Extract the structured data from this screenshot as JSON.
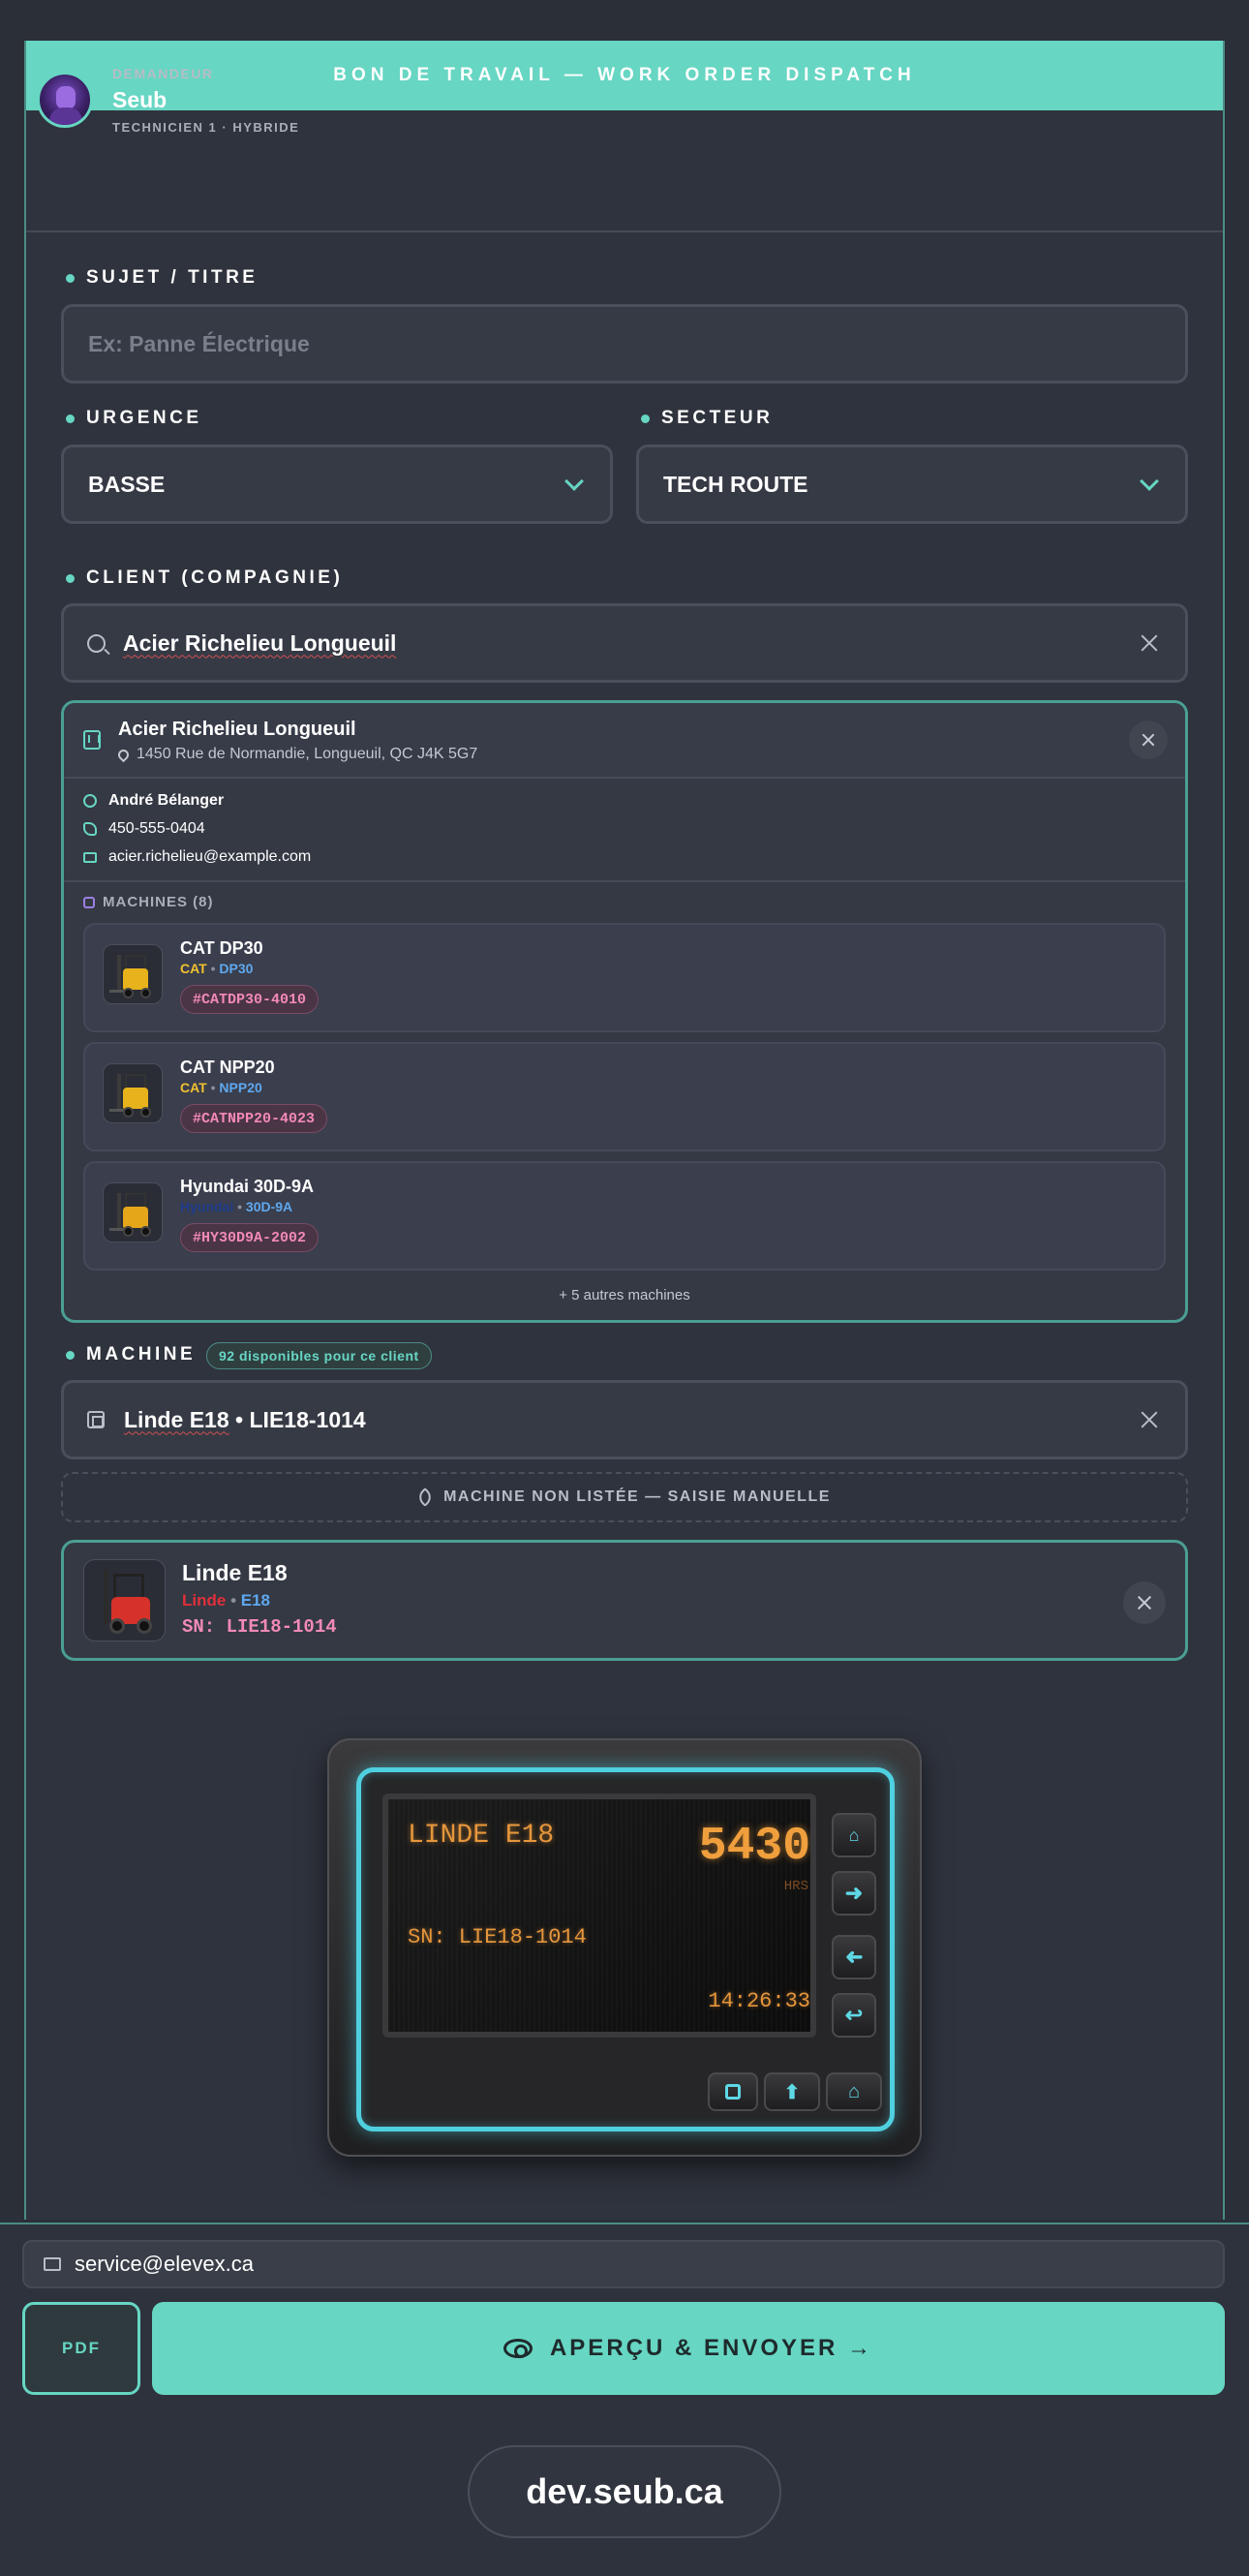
{
  "header": {
    "banner": "BON DE TRAVAIL — WORK ORDER DISPATCH"
  },
  "requester": {
    "label": "DEMANDEUR",
    "name": "Seub",
    "role": "TECHNICIEN 1 · HYBRIDE"
  },
  "form": {
    "subject": {
      "label": "SUJET / TITRE",
      "placeholder": "Ex: Panne Électrique",
      "value": ""
    },
    "urgency": {
      "label": "URGENCE",
      "value": "BASSE"
    },
    "sector": {
      "label": "SECTEUR",
      "value": "TECH ROUTE"
    },
    "client": {
      "label": "CLIENT (COMPAGNIE)",
      "value": "Acier Richelieu Longueuil"
    }
  },
  "client_card": {
    "name": "Acier Richelieu Longueuil",
    "address": "1450 Rue de Normandie, Longueuil, QC J4K 5G7",
    "contact_name": "André Bélanger",
    "phone": "450-555-0404",
    "email": "acier.richelieu@example.com",
    "machines_label": "MACHINES (8)",
    "machines": [
      {
        "name": "CAT DP30",
        "brand": "CAT",
        "brand_color": "#f2c12e",
        "model": "DP30",
        "tag": "#CATDP30-4010"
      },
      {
        "name": "CAT NPP20",
        "brand": "CAT",
        "brand_color": "#f2c12e",
        "model": "NPP20",
        "tag": "#CATNPP20-4023"
      },
      {
        "name": "Hyundai 30D-9A",
        "brand": "Hyundai",
        "brand_color": "#1f3c8a",
        "model": "30D-9A",
        "tag": "#HY30D9A-2002"
      }
    ],
    "more": "+ 5 autres machines"
  },
  "machine_field": {
    "label": "MACHINE",
    "badge": "92 disponibles pour ce client",
    "value_name": "Linde E18",
    "value_sep": " • ",
    "value_serial": "LIE18-1014",
    "manual_button": "MACHINE NON LISTÉE — SAISIE MANUELLE"
  },
  "selected_machine": {
    "name": "Linde E18",
    "brand": "Linde",
    "brand_color": "#e0303a",
    "model": "E18",
    "serial": "SN: LIE18-1014"
  },
  "display": {
    "machine": "LINDE E18",
    "hours": "5430",
    "hours_unit": "HRS",
    "serial": "SN: LIE18-1014",
    "time": "14:26:33"
  },
  "footer": {
    "email": "service@elevex.ca",
    "pdf_label": "PDF",
    "send_label": "APERÇU & ENVOYER →",
    "domain": "dev.seub.ca"
  },
  "colors": {
    "accent": "#67d6c3",
    "model": "#5fa8ef",
    "tag": "#f28ab5",
    "display_amber": "#f09e3b",
    "display_glow": "#4fd0e0"
  }
}
